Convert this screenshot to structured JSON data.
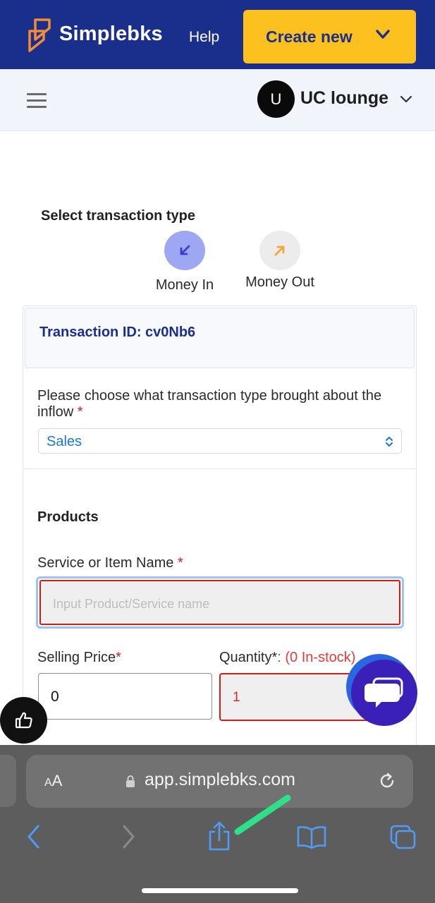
{
  "header": {
    "brand": "Simplebks",
    "help_label": "Help",
    "create_label": "Create new"
  },
  "subheader": {
    "avatar_initial": "U",
    "org_name": "UC lounge"
  },
  "transaction_type": {
    "label": "Select transaction type",
    "money_in": "Money In",
    "money_out": "Money Out",
    "selected": "Money In"
  },
  "form": {
    "transaction_id": "Transaction ID: cv0Nb6",
    "inflow_question": "Please choose what transaction type brought about the inflow",
    "required_mark": "*",
    "inflow_select_value": "Sales",
    "products_heading": "Products",
    "item_name_label": "Service or Item Name",
    "item_name_placeholder": "Input Product/Service name",
    "selling_price_label": "Selling Price",
    "selling_price_value": "0",
    "quantity_label": "Quantity",
    "quantity_colon": ":",
    "stock_text": " (0 In-stock)",
    "quantity_value": "1"
  },
  "browser": {
    "text_size_label_small": "A",
    "text_size_label_large": "A",
    "url": "app.simplebks.com"
  },
  "colors": {
    "brand_navy": "#1a2f8c",
    "accent_yellow": "#fdc11f",
    "error_red": "#d51a1a",
    "link_blue": "#1f77d0",
    "chat_purple": "#3a1fb8",
    "browser_blue": "#4f9cf5"
  }
}
